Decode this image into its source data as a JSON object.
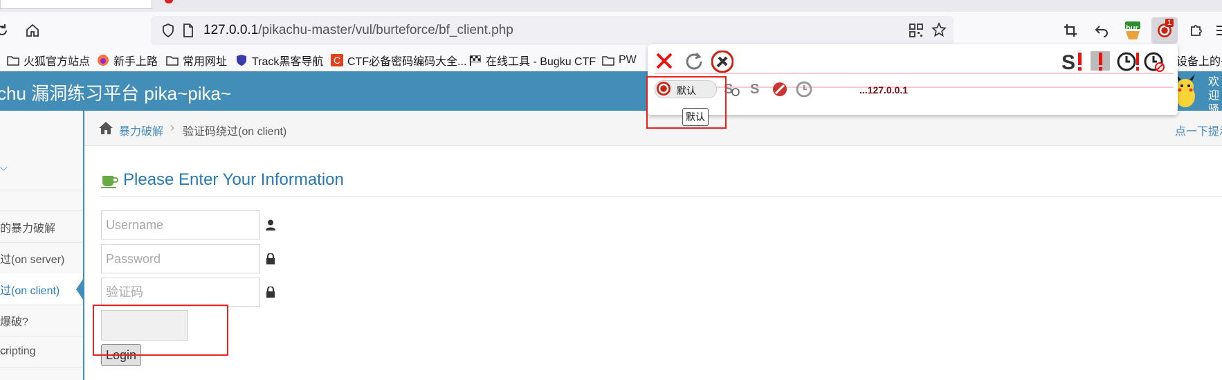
{
  "browser": {
    "url_host": "127.0.0.1",
    "url_path": "/pikachu-master/vul/burteforce/bf_client.php",
    "extension_badge": "1",
    "burp_label": "bur",
    "bookmarks": [
      {
        "label": "火狐官方站点",
        "icon": "folder-icon"
      },
      {
        "label": "新手上路",
        "icon": "firefox-icon"
      },
      {
        "label": "常用网址",
        "icon": "folder-icon"
      },
      {
        "label": "Track黑客导航",
        "icon": "shield-icon"
      },
      {
        "label": "CTF必备密码编码大全...",
        "icon": "c-icon"
      },
      {
        "label": "在线工具 - Bugku CTF",
        "icon": "flag-icon"
      },
      {
        "label": "PW",
        "icon": "folder-icon"
      }
    ],
    "bookmarks_overflow": "设备上的书"
  },
  "page": {
    "header_title": "chu 漏洞练习平台 pika~pika~",
    "header_welcome": "欢迎 骚",
    "breadcrumb": {
      "crumb1": "暴力破解",
      "separator": "›",
      "crumb2": "验证码绕过(on client)",
      "hint": "点一下提示"
    },
    "sidebar": {
      "items": [
        {
          "label": "的暴力破解"
        },
        {
          "label": "过(on server)"
        },
        {
          "label": "过(on client)"
        },
        {
          "label": "爆破?"
        },
        {
          "label": "cripting"
        }
      ]
    },
    "form": {
      "title": "Please Enter Your Information",
      "username_placeholder": "Username",
      "password_placeholder": "Password",
      "captcha_placeholder": "验证码",
      "login_label": "Login"
    }
  },
  "extension_popup": {
    "toggle_label": "默认",
    "tooltip": "默认",
    "status_text": "...127.0.0.1"
  },
  "colors": {
    "header_bg": "#438eb9",
    "link": "#4c8fbd",
    "highlight_red": "#e8221c"
  }
}
